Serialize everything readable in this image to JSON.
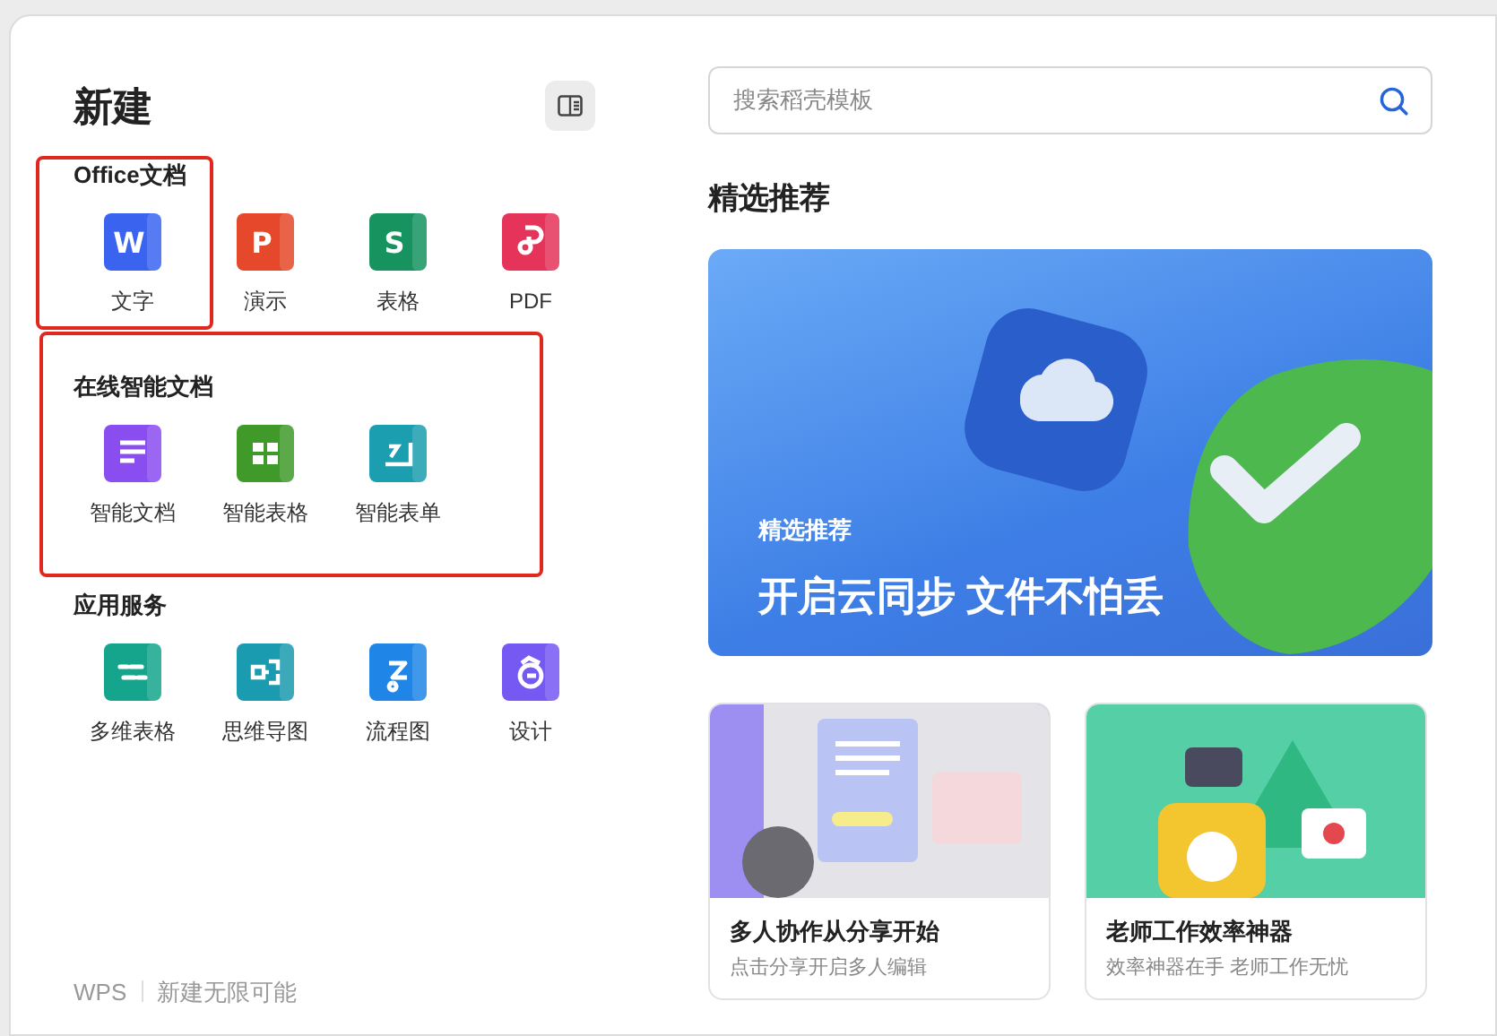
{
  "title": "新建",
  "sections": [
    {
      "heading": "Office文档",
      "highlighted": false,
      "items": [
        {
          "label": "文字",
          "kind": "letter",
          "glyph": "W",
          "color": "#3a64f0",
          "highlighted": true
        },
        {
          "label": "演示",
          "kind": "letter",
          "glyph": "P",
          "color": "#e5482a",
          "highlighted": false
        },
        {
          "label": "表格",
          "kind": "letter",
          "glyph": "S",
          "color": "#16935f",
          "highlighted": false
        },
        {
          "label": "PDF",
          "kind": "pdf",
          "color": "#e5335a",
          "highlighted": false
        }
      ]
    },
    {
      "heading": "在线智能文档",
      "highlighted": true,
      "items": [
        {
          "label": "智能文档",
          "kind": "lines",
          "color": "#8a4df0",
          "highlighted": false
        },
        {
          "label": "智能表格",
          "kind": "grid",
          "color": "#3f9a2a",
          "highlighted": false
        },
        {
          "label": "智能表单",
          "kind": "form",
          "color": "#1b9eb0",
          "highlighted": false
        }
      ]
    },
    {
      "heading": "应用服务",
      "highlighted": false,
      "items": [
        {
          "label": "多维表格",
          "kind": "multi",
          "color": "#14a58c",
          "highlighted": false
        },
        {
          "label": "思维导图",
          "kind": "mindmap",
          "color": "#1a9bb0",
          "highlighted": false
        },
        {
          "label": "流程图",
          "kind": "flow",
          "color": "#1f86e8",
          "highlighted": false
        },
        {
          "label": "设计",
          "kind": "design",
          "color": "#7658f2",
          "highlighted": false
        }
      ]
    }
  ],
  "footer": {
    "brand": "WPS",
    "slogan": "新建无限可能"
  },
  "search": {
    "placeholder": "搜索稻壳模板"
  },
  "featured": {
    "heading": "精选推荐",
    "banner": {
      "tag": "精选推荐",
      "title": "开启云同步 文件不怕丢"
    },
    "cards": [
      {
        "kind": "share",
        "title": "多人协作从分享开始",
        "subtitle": "点击分享开启多人编辑"
      },
      {
        "kind": "teacher",
        "title": "老师工作效率神器",
        "subtitle": "效率神器在手 老师工作无忧"
      }
    ]
  }
}
